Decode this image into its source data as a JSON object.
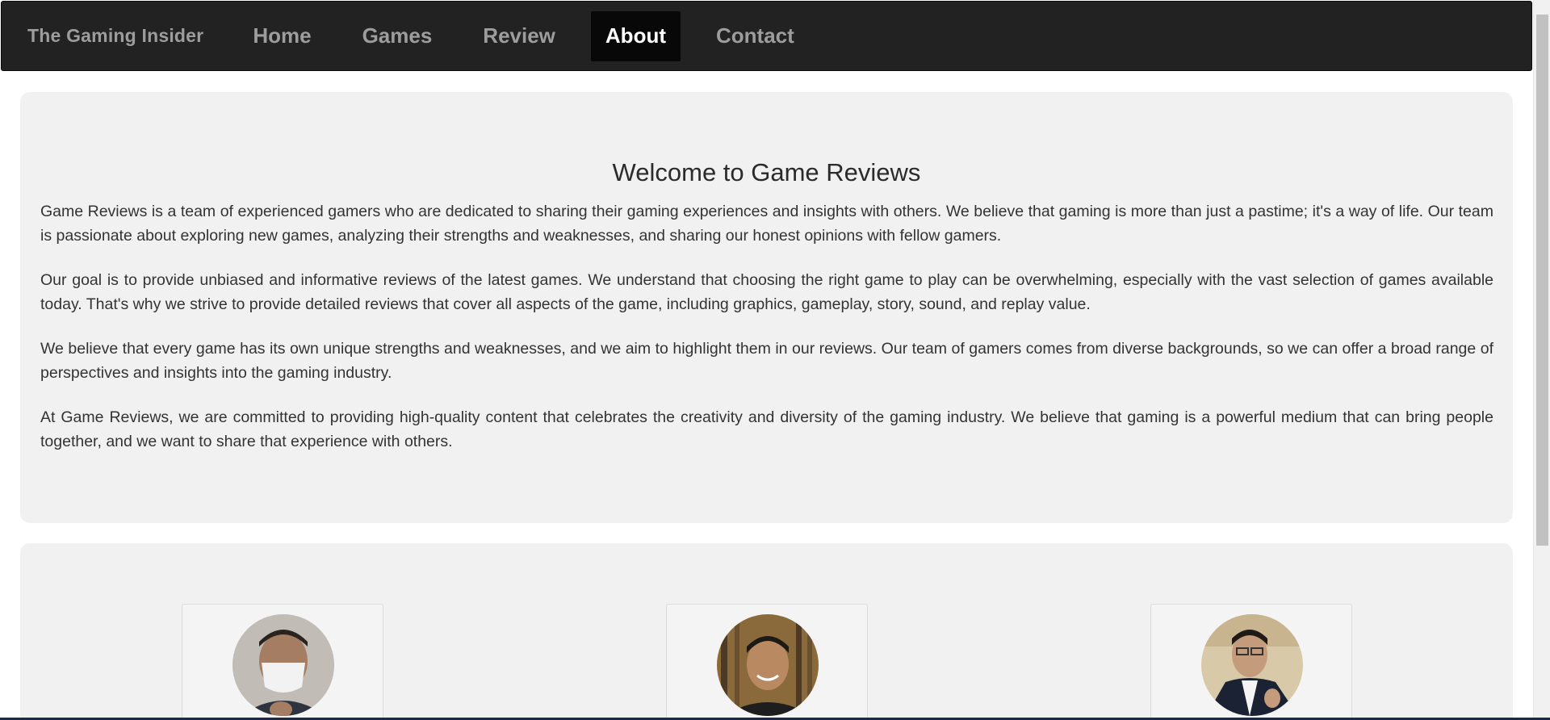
{
  "navbar": {
    "brand": "The Gaming Insider",
    "items": [
      {
        "label": "Home",
        "active": false
      },
      {
        "label": "Games",
        "active": false
      },
      {
        "label": "Review",
        "active": false
      },
      {
        "label": "About",
        "active": true
      },
      {
        "label": "Contact",
        "active": false
      }
    ]
  },
  "about": {
    "title": "Welcome to Game Reviews",
    "paragraphs": [
      "Game Reviews is a team of experienced gamers who are dedicated to sharing their gaming experiences and insights with others. We believe that gaming is more than just a pastime; it's a way of life. Our team is passionate about exploring new games, analyzing their strengths and weaknesses, and sharing our honest opinions with fellow gamers.",
      "Our goal is to provide unbiased and informative reviews of the latest games. We understand that choosing the right game to play can be overwhelming, especially with the vast selection of games available today. That's why we strive to provide detailed reviews that cover all aspects of the game, including graphics, gameplay, story, sound, and replay value.",
      "We believe that every game has its own unique strengths and weaknesses, and we aim to highlight them in our reviews. Our team of gamers comes from diverse backgrounds, so we can offer a broad range of perspectives and insights into the gaming industry.",
      "At Game Reviews, we are committed to providing high-quality content that celebrates the creativity and diversity of the gaming industry. We believe that gaming is a powerful medium that can bring people together, and we want to share that experience with others."
    ]
  },
  "team": {
    "members": [
      {
        "avatar": "team-member-1-photo"
      },
      {
        "avatar": "team-member-2-photo"
      },
      {
        "avatar": "team-member-3-photo"
      }
    ]
  },
  "colors": {
    "navbar_bg": "#222222",
    "nav_text": "#9d9d9d",
    "nav_active_bg": "#080808",
    "nav_active_text": "#ffffff",
    "panel_bg": "#f1f1f1",
    "body_text": "#333333"
  }
}
